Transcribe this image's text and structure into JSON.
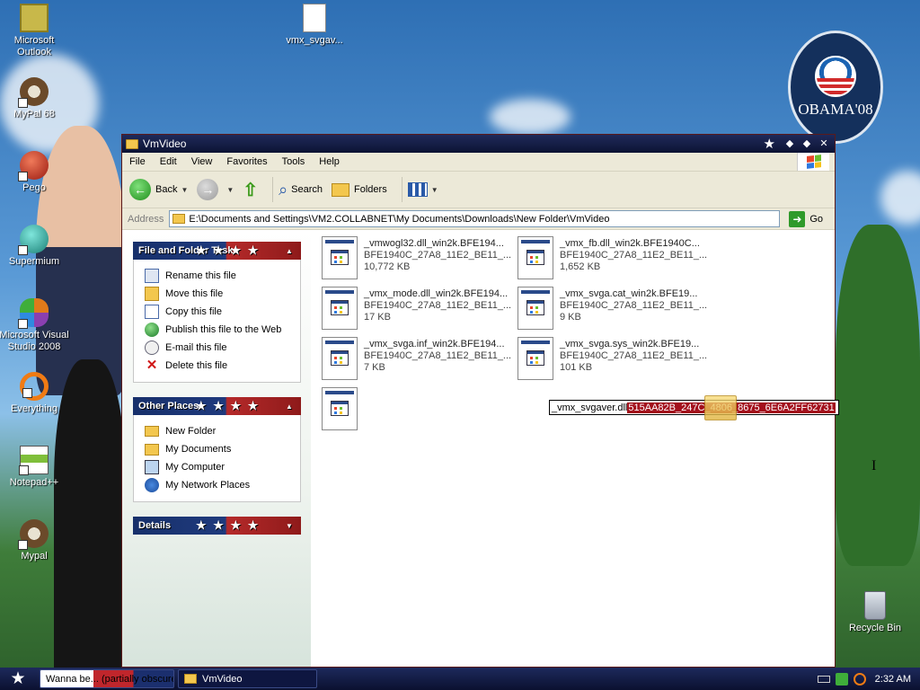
{
  "desktop": {
    "icons": [
      {
        "label": "Microsoft Outlook",
        "color": "#c8b84a"
      },
      {
        "label": "MyPal 68",
        "color": "#6b4a2a"
      },
      {
        "label": "Pego",
        "color": "#c4331f"
      },
      {
        "label": "Supermium",
        "color": "#2fa89a"
      },
      {
        "label": "Microsoft Visual Studio 2008",
        "color": "#e07a1a"
      },
      {
        "label": "Everything",
        "color": "#f07b14"
      },
      {
        "label": "Notepad++",
        "color": "#7fbf3a"
      },
      {
        "label": "Mypal",
        "color": "#6b4a2a"
      },
      {
        "label": "vmx_svgav...",
        "color": "#3f8fd6"
      },
      {
        "label": "Recycle Bin",
        "color": "#9aa3b0"
      }
    ],
    "badge_text": "OBAMA'08"
  },
  "window": {
    "title": "VmVideo",
    "menu": [
      "File",
      "Edit",
      "View",
      "Favorites",
      "Tools",
      "Help"
    ],
    "toolbar": {
      "back": "Back",
      "search": "Search",
      "folders": "Folders"
    },
    "address": {
      "label": "Address",
      "path": "E:\\Documents and Settings\\VM2.COLLABNET\\My Documents\\Downloads\\New Folder\\VmVideo",
      "go": "Go"
    },
    "tasks": {
      "file_folder": {
        "title": "File and Folder Tasks",
        "items": [
          "Rename this file",
          "Move this file",
          "Copy this file",
          "Publish this file to the Web",
          "E-mail this file",
          "Delete this file"
        ]
      },
      "other_places": {
        "title": "Other Places",
        "items": [
          "New Folder",
          "My Documents",
          "My Computer",
          "My Network Places"
        ]
      },
      "details": {
        "title": "Details"
      }
    },
    "files": [
      {
        "name": "_vmwogl32.dll_win2k.BFE194...",
        "sub": "BFE1940C_27A8_11E2_BE11_...",
        "size": "10,772 KB"
      },
      {
        "name": "_vmx_fb.dll_win2k.BFE1940C...",
        "sub": "BFE1940C_27A8_11E2_BE11_...",
        "size": "1,652 KB"
      },
      {
        "name": "_vmx_mode.dll_win2k.BFE194...",
        "sub": "BFE1940C_27A8_11E2_BE11_...",
        "size": "17 KB"
      },
      {
        "name": "_vmx_svga.cat_win2k.BFE19...",
        "sub": "BFE1940C_27A8_11E2_BE11_...",
        "size": "9 KB"
      },
      {
        "name": "_vmx_svga.inf_win2k.BFE194...",
        "sub": "BFE1940C_27A8_11E2_BE11_...",
        "size": "7 KB"
      },
      {
        "name": "_vmx_svga.sys_win2k.BFE19...",
        "sub": "BFE1940C_27A8_11E2_BE11_...",
        "size": "101 KB"
      }
    ],
    "rename": {
      "prefix": "_vmx_svgaver.dll",
      "selected": "515AA82B_247C_4806_8675_6E6A2FF62731"
    }
  },
  "taskbar": {
    "tasks": [
      {
        "label": "Wanna be... (partially obscured)"
      },
      {
        "label": "VmVideo"
      }
    ],
    "time": "2:32 AM"
  }
}
